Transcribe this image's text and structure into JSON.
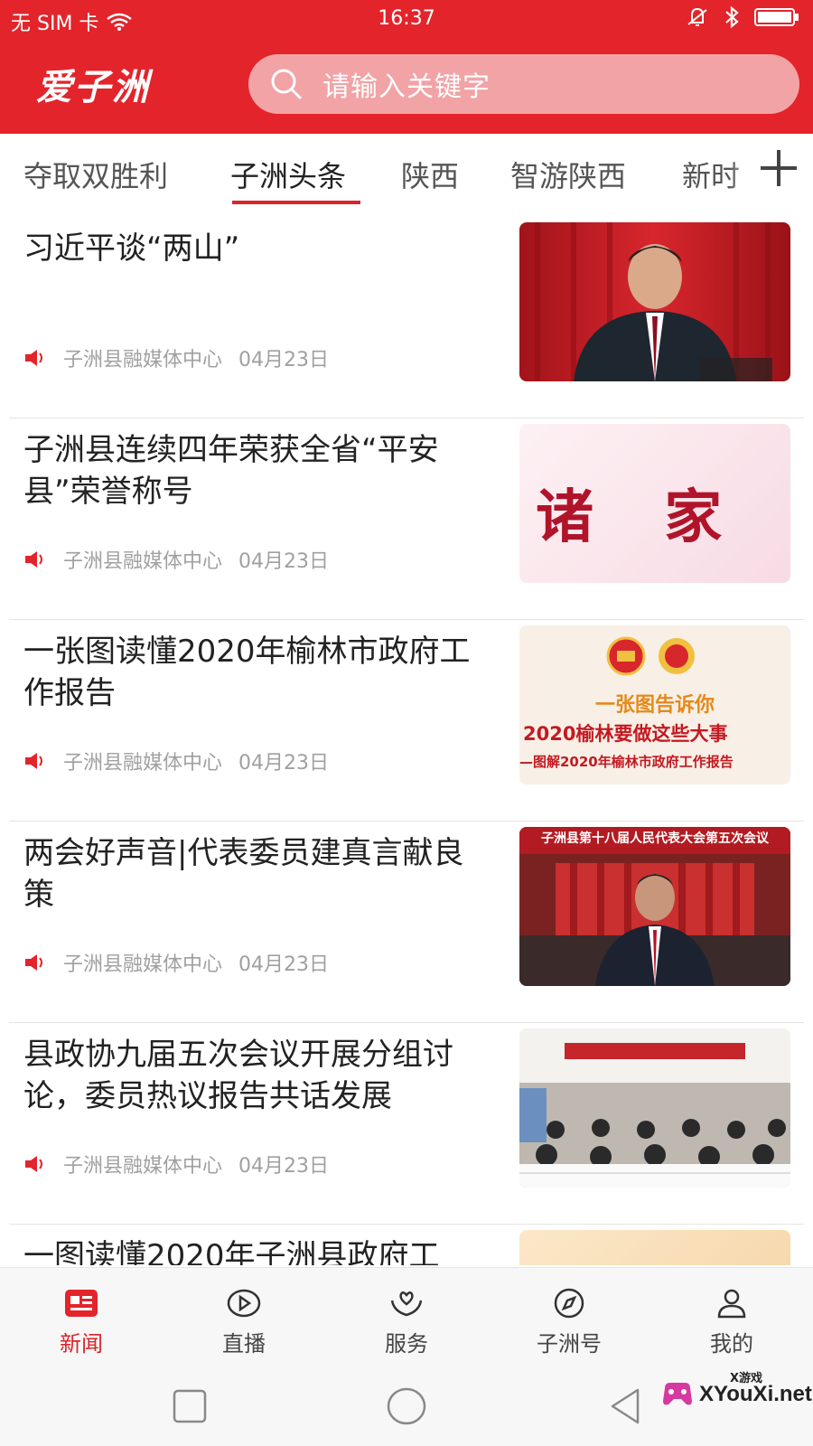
{
  "status_bar": {
    "carrier": "无 SIM 卡",
    "time": "16:37",
    "icons": [
      "wifi-icon",
      "mute-icon",
      "bluetooth-icon",
      "battery-icon"
    ]
  },
  "header": {
    "logo_text": "爱子洲",
    "search_placeholder": "请输入关键字"
  },
  "tabs": [
    {
      "label": "夺取双胜利"
    },
    {
      "label": "子洲头条"
    },
    {
      "label": "陕西"
    },
    {
      "label": "智游陕西"
    },
    {
      "label": "新时"
    }
  ],
  "active_tab": "子洲头条",
  "news": [
    {
      "title": "习近平谈“两山”",
      "source": "子洲县融媒体中心",
      "date": "04月23日"
    },
    {
      "title": "子洲县连续四年荣获全省“平安县”荣誉称号",
      "source": "子洲县融媒体中心",
      "date": "04月23日",
      "thumb_text": "诸 家"
    },
    {
      "title": "一张图读懂2020年榆林市政府工作报告",
      "source": "子洲县融媒体中心",
      "date": "04月23日",
      "thumb_lines": [
        "一张图告诉你",
        "2020榆林要做这些大事",
        "—图解2020年榆林市政府工作报告"
      ]
    },
    {
      "title": "两会好声音|代表委员建真言献良策",
      "source": "子洲县融媒体中心",
      "date": "04月23日",
      "thumb_banner": "子洲县第十八届人民代表大会第五次会议"
    },
    {
      "title": "县政协九届五次会议开展分组讨论，委员热议报告共话发展",
      "source": "子洲县融媒体中心",
      "date": "04月23日"
    },
    {
      "title": "一图读懂2020年子洲县政府工",
      "source": "",
      "date": ""
    }
  ],
  "bottom_nav": [
    {
      "label": "新闻",
      "icon": "news-icon"
    },
    {
      "label": "直播",
      "icon": "play-icon"
    },
    {
      "label": "服务",
      "icon": "heart-hands-icon"
    },
    {
      "label": "子洲号",
      "icon": "compass-icon"
    },
    {
      "label": "我的",
      "icon": "person-icon"
    }
  ],
  "watermark": {
    "small": "X游戏",
    "text": "XYouXi.net"
  },
  "colors": {
    "brand": "#e3242b",
    "accent": "#d9252b"
  }
}
